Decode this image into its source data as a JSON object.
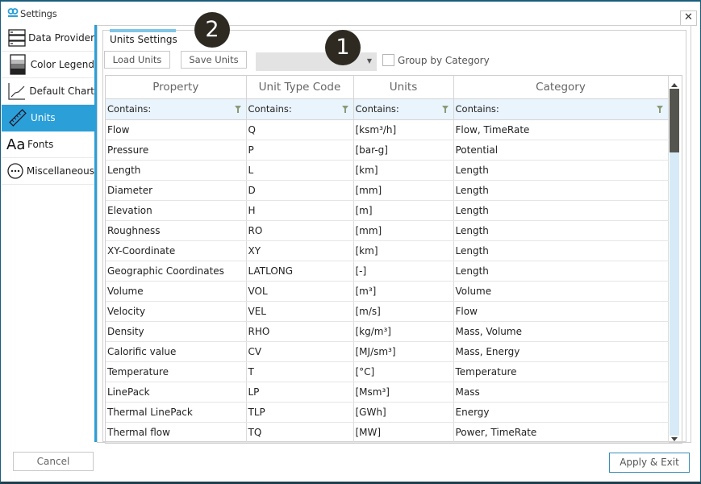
{
  "window": {
    "title": "Settings",
    "close_glyph": "✕",
    "accent_color": "#2a9fd8"
  },
  "sidebar": {
    "items": [
      {
        "label": "Data Provider",
        "icon": "server-stack-icon",
        "active": false
      },
      {
        "label": "Color Legend",
        "icon": "color-legend-icon",
        "active": false
      },
      {
        "label": "Default Chart",
        "icon": "line-chart-icon",
        "active": false
      },
      {
        "label": "Units",
        "icon": "ruler-icon",
        "active": true
      },
      {
        "label": "Fonts",
        "icon": "font-aa-icon",
        "icon_text": "Aa",
        "active": false
      },
      {
        "label": "Miscellaneous",
        "icon": "ellipsis-circle-icon",
        "active": false
      }
    ]
  },
  "main": {
    "tab_label": "Units Settings",
    "load_button": "Load Units",
    "save_button": "Save Units",
    "combo_value": "",
    "combo_arrow": "▼",
    "group_by_label": "Group by Category",
    "group_by_checked": false,
    "badges": [
      "1",
      "2"
    ]
  },
  "grid": {
    "columns": [
      "Property",
      "Unit Type Code",
      "Units",
      "Category"
    ],
    "filter_placeholder": "Contains:",
    "rows": [
      {
        "property": "Flow",
        "code": "Q",
        "units": "[ksm³/h]",
        "category": "Flow, TimeRate"
      },
      {
        "property": "Pressure",
        "code": "P",
        "units": "[bar-g]",
        "category": "Potential"
      },
      {
        "property": "Length",
        "code": "L",
        "units": "[km]",
        "category": "Length"
      },
      {
        "property": "Diameter",
        "code": "D",
        "units": "[mm]",
        "category": "Length"
      },
      {
        "property": "Elevation",
        "code": "H",
        "units": "[m]",
        "category": "Length"
      },
      {
        "property": "Roughness",
        "code": "RO",
        "units": "[mm]",
        "category": "Length"
      },
      {
        "property": "XY-Coordinate",
        "code": "XY",
        "units": "[km]",
        "category": "Length"
      },
      {
        "property": "Geographic Coordinates",
        "code": "LATLONG",
        "units": "[-]",
        "category": "Length"
      },
      {
        "property": "Volume",
        "code": "VOL",
        "units": "[m³]",
        "category": "Volume"
      },
      {
        "property": "Velocity",
        "code": "VEL",
        "units": "[m/s]",
        "category": "Flow"
      },
      {
        "property": "Density",
        "code": "RHO",
        "units": "[kg/m³]",
        "category": "Mass, Volume"
      },
      {
        "property": "Calorific value",
        "code": "CV",
        "units": "[MJ/sm³]",
        "category": "Mass, Energy"
      },
      {
        "property": "Temperature",
        "code": "T",
        "units": "[°C]",
        "category": "Temperature"
      },
      {
        "property": "LinePack",
        "code": "LP",
        "units": "[Msm³]",
        "category": "Mass"
      },
      {
        "property": "Thermal LinePack",
        "code": "TLP",
        "units": "[GWh]",
        "category": "Energy"
      },
      {
        "property": "Thermal flow",
        "code": "TQ",
        "units": "[MW]",
        "category": "Power, TimeRate"
      }
    ]
  },
  "footer": {
    "cancel_button": "Cancel",
    "apply_button": "Apply & Exit"
  }
}
